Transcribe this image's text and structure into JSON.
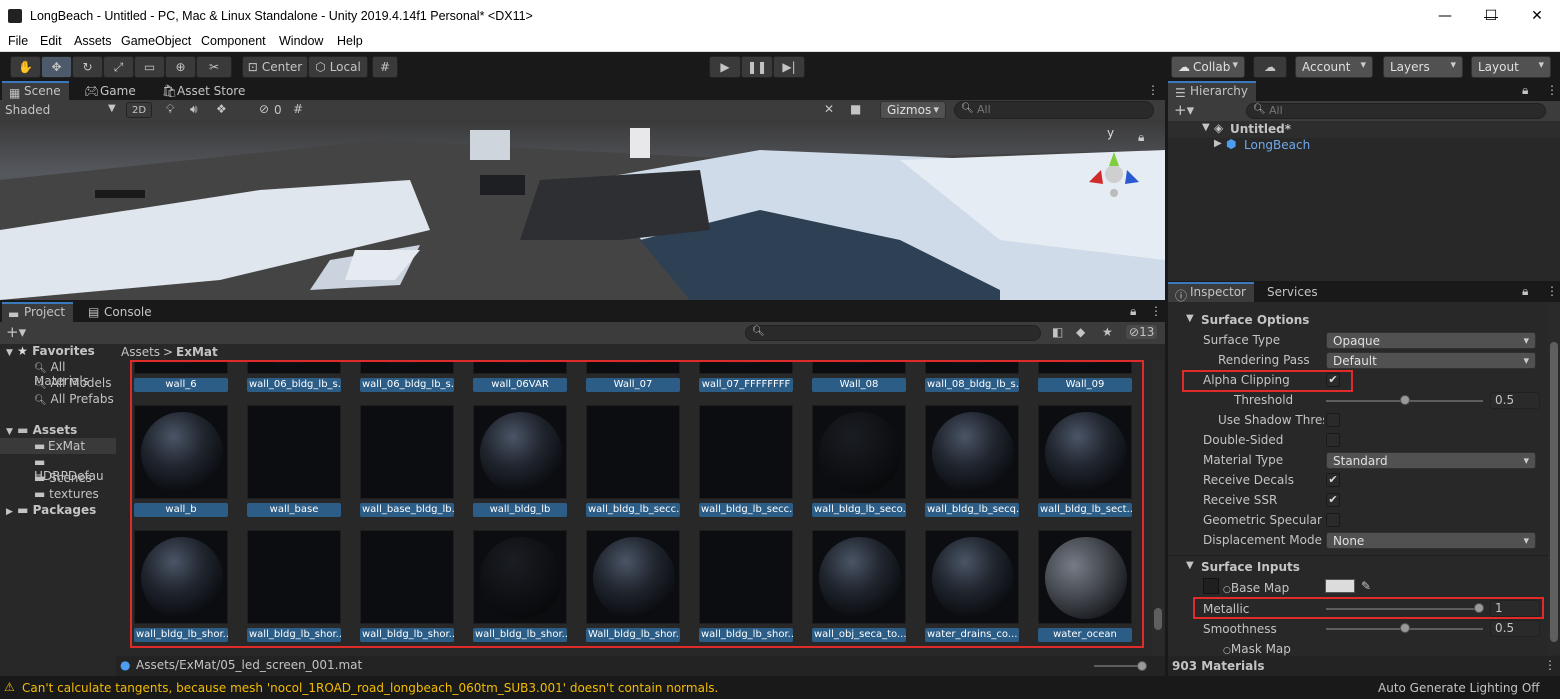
{
  "window": {
    "title": "LongBeach - Untitled - PC, Mac & Linux Standalone - Unity 2019.4.14f1 Personal* <DX11>",
    "minimize": "—",
    "maximize": "☐",
    "close": "✕"
  },
  "menu": [
    "File",
    "Edit",
    "Assets",
    "GameObject",
    "Component",
    "Window",
    "Help"
  ],
  "toolbar": {
    "pivot": "Center",
    "space": "Local",
    "collab": "Collab",
    "account": "Account",
    "layers": "Layers",
    "layout": "Layout"
  },
  "scene_tabs": {
    "scene": "Scene",
    "game": "Game",
    "asset_store": "Asset Store"
  },
  "scene_bar": {
    "shading": "Shaded",
    "mode2d": "2D",
    "hidden_count": "0",
    "gizmos": "Gizmos",
    "search_placeholder": "All"
  },
  "gizmo_axis": "y",
  "hierarchy": {
    "tab": "Hierarchy",
    "search_placeholder": "All",
    "scene": "Untitled*",
    "child": "LongBeach"
  },
  "project": {
    "tab_project": "Project",
    "tab_console": "Console",
    "count": "13",
    "breadcrumb_root": "Assets",
    "breadcrumb_sep": ">",
    "breadcrumb_current": "ExMat",
    "favorites": {
      "label": "Favorites",
      "items": [
        "All Materials",
        "All Models",
        "All Prefabs"
      ]
    },
    "assets": {
      "label": "Assets",
      "items": [
        "ExMat",
        "HDRPDefau",
        "Scenes",
        "textures"
      ]
    },
    "packages": "Packages",
    "selected_path": "Assets/ExMat/05_led_screen_001.mat"
  },
  "grid": {
    "row0": [
      "wall_6",
      "wall_06_bldg_lb_s...",
      "wall_06_bldg_lb_s...",
      "wall_06VAR",
      "Wall_07",
      "wall_07_FFFFFFFF",
      "Wall_08",
      "wall_08_bldg_lb_s...",
      "Wall_09"
    ],
    "row1": [
      "wall_b",
      "wall_base",
      "wall_base_bldg_lb...",
      "wall_bldg_lb",
      "wall_bldg_lb_secc...",
      "wall_bldg_lb_secc...",
      "wall_bldg_lb_seco...",
      "wall_bldg_lb_secq...",
      "wall_bldg_lb_sect..."
    ],
    "row2": [
      "wall_bldg_lb_shor...",
      "wall_bldg_lb_shor...",
      "wall_bldg_lb_shor...",
      "wall_bldg_lb_shor...",
      "Wall_bldg_lb_shor...",
      "wall_bldg_lb_shor...",
      "wall_obj_seca_to...",
      "water_drains_co...",
      "water_ocean"
    ]
  },
  "inspector": {
    "tab_inspector": "Inspector",
    "tab_services": "Services",
    "surface_options": "Surface Options",
    "surface_type_label": "Surface Type",
    "surface_type_value": "Opaque",
    "rendering_pass_label": "Rendering Pass",
    "rendering_pass_value": "Default",
    "alpha_clipping_label": "Alpha Clipping",
    "alpha_clipping_checked": "✔",
    "threshold_label": "Threshold",
    "threshold_value": "0.5",
    "use_shadow_label": "Use Shadow Thres",
    "double_sided_label": "Double-Sided",
    "material_type_label": "Material Type",
    "material_type_value": "Standard",
    "receive_decals_label": "Receive Decals",
    "receive_decals_checked": "✔",
    "receive_ssr_label": "Receive SSR",
    "receive_ssr_checked": "✔",
    "geometric_label": "Geometric Specular A",
    "displacement_label": "Displacement Mode",
    "displacement_value": "None",
    "surface_inputs": "Surface Inputs",
    "base_map_label": "Base Map",
    "metallic_label": "Metallic",
    "metallic_value": "1",
    "smoothness_label": "Smoothness",
    "smoothness_value": "0.5",
    "mask_map_label": "Mask Map",
    "footer": "903 Materials"
  },
  "status": {
    "warning": "Can't calculate tangents, because mesh 'nocol_1ROAD_road_longbeach_060tm_SUB3.001' doesn't contain normals.",
    "right": "Auto Generate Lighting Off"
  },
  "colors": {
    "accent": "#3a79bb",
    "selection": "#2c5d87",
    "highlight_box": "#e02b2b",
    "warning": "#f4bc02"
  }
}
